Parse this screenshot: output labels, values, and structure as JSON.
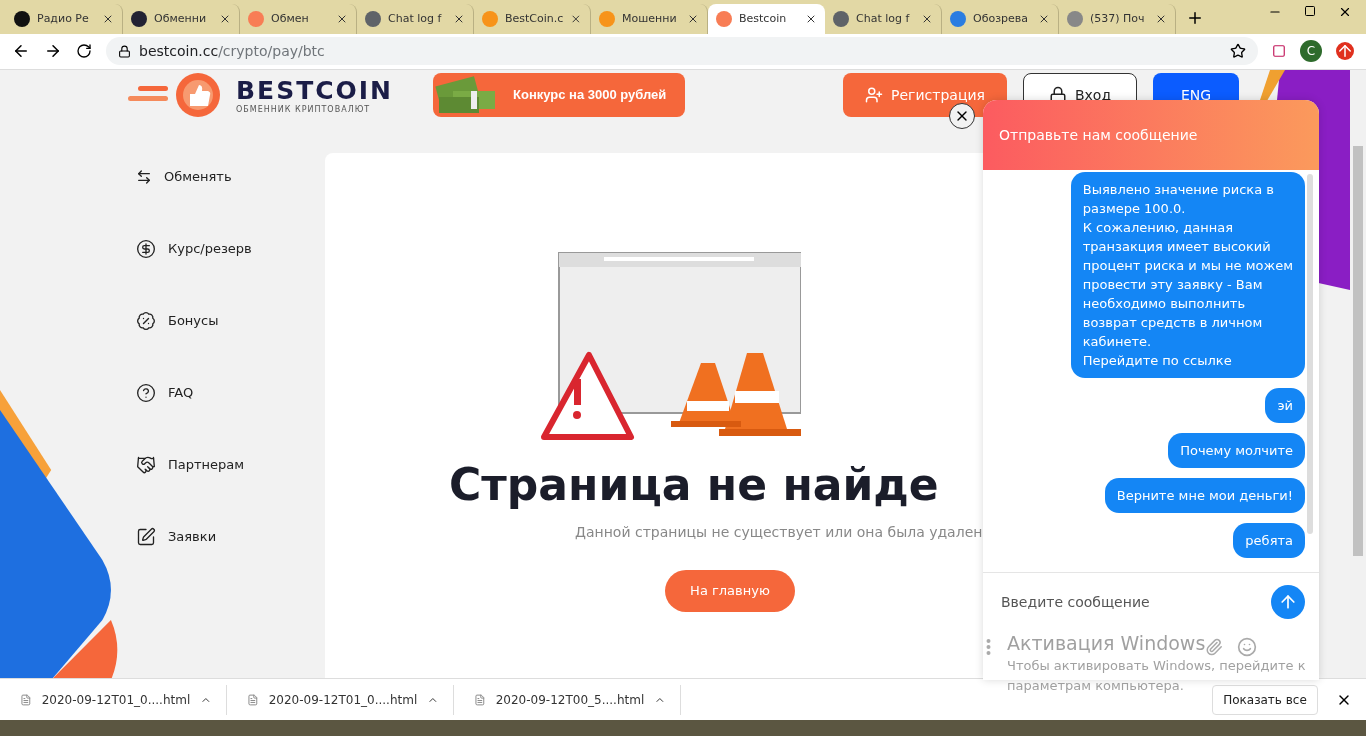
{
  "browser": {
    "tabs": [
      {
        "title": "Радио Ре",
        "selected": false
      },
      {
        "title": "Обменни",
        "selected": false
      },
      {
        "title": "Обмен",
        "selected": false
      },
      {
        "title": "Chat log f",
        "selected": false
      },
      {
        "title": "BestCoin.c",
        "selected": false
      },
      {
        "title": "Мошенни",
        "selected": false
      },
      {
        "title": "Bestcoin",
        "selected": true
      },
      {
        "title": "Chat log f",
        "selected": false
      },
      {
        "title": "Обозрева",
        "selected": false
      },
      {
        "title": "(537) Поч",
        "selected": false
      }
    ],
    "url_host": "bestcoin.cc",
    "url_path": "/crypto/pay/btc",
    "profile_initial": "C"
  },
  "header": {
    "logo_name": "BESTCOIN",
    "logo_tagline": "ОБМЕННИК КРИПТОВАЛЮТ",
    "contest": "Конкурс на 3000 рублей",
    "register": "Регистрация",
    "login": "Вход",
    "language": "ENG"
  },
  "sidebar": {
    "items": [
      {
        "label": "Обменять"
      },
      {
        "label": "Курс/резерв"
      },
      {
        "label": "Бонусы"
      },
      {
        "label": "FAQ"
      },
      {
        "label": "Партнерам"
      },
      {
        "label": "Заявки"
      }
    ]
  },
  "error": {
    "title": "Страница не найде",
    "subtitle": "Данной страницы не существует или она была удален",
    "home_button": "На главную"
  },
  "chat": {
    "title": "Отправьте нам сообщение",
    "messages": [
      "Выявлено значение риска в\nразмере 100.0.\nК сожалению, данная\nтранзакция имеет высокий\nпроцент риска и мы не можем\nпровести эту заявку - Вам\nнеобходимо выполнить\nвозврат средств в личном\nкабинете.\nПерейдите по ссылке",
      "эй",
      "Почему молчите",
      "Верните мне мои деньги!",
      "ребята"
    ],
    "input_placeholder": "Введите сообщение"
  },
  "windows_activation": {
    "title": "Активация Windows",
    "text": "Чтобы активировать Windows, перейдите к\nпараметрам компьютера."
  },
  "downloads": {
    "files": [
      "2020-09-12T01_0....html",
      "2020-09-12T01_0....html",
      "2020-09-12T00_5....html"
    ],
    "show_all": "Показать все"
  }
}
